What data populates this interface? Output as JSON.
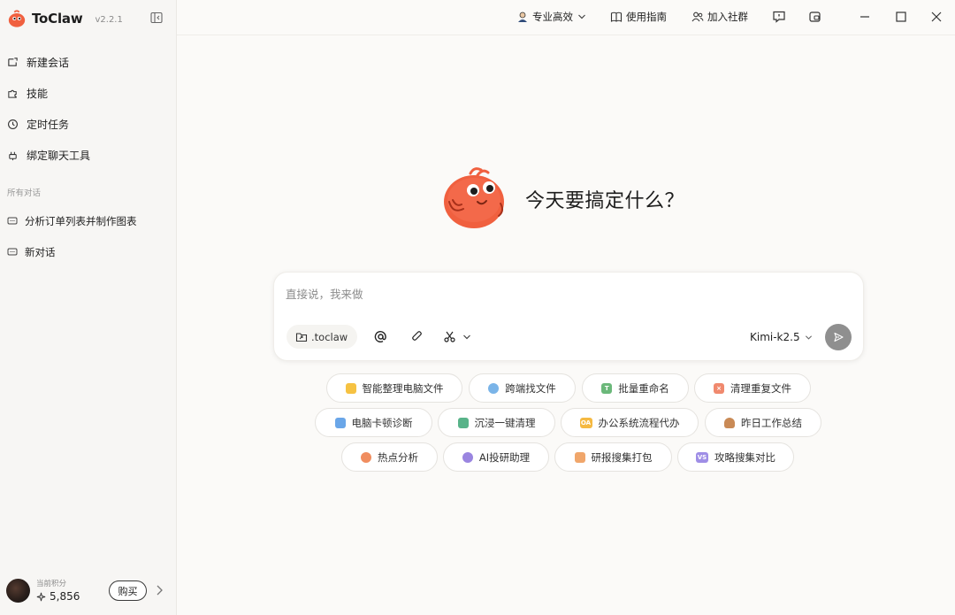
{
  "app": {
    "name": "ToClaw",
    "version": "v2.2.1"
  },
  "sidebar": {
    "nav": [
      {
        "label": "新建会话",
        "icon": "new-chat-icon"
      },
      {
        "label": "技能",
        "icon": "puzzle-icon"
      },
      {
        "label": "定时任务",
        "icon": "clock-icon"
      },
      {
        "label": "绑定聊天工具",
        "icon": "plug-icon"
      }
    ],
    "section_label": "所有对话",
    "chats": [
      {
        "label": "分析订单列表并制作图表",
        "icon": "chat-bubble-icon"
      },
      {
        "label": "新对话",
        "icon": "chat-bubble-icon"
      }
    ],
    "footer": {
      "points_label": "当前积分",
      "points_value": "5,856",
      "buy_label": "购买"
    }
  },
  "topbar": {
    "mode_label": "专业高效",
    "guide_label": "使用指南",
    "community_label": "加入社群"
  },
  "hero": {
    "title": "今天要搞定什么？"
  },
  "composer": {
    "placeholder": "直接说，我来做",
    "folder_label": ".toclaw",
    "model_label": "Kimi-k2.5"
  },
  "suggestions": [
    {
      "label": "智能整理电脑文件",
      "icon": "folder-icon",
      "color": "#f6c242"
    },
    {
      "label": "跨端找文件",
      "icon": "search-icon",
      "color": "#7ab4e8"
    },
    {
      "label": "批量重命名",
      "icon": "rename-icon",
      "color": "#6bb87a",
      "glyph": "T"
    },
    {
      "label": "清理重复文件",
      "icon": "delete-icon",
      "color": "#f0896e"
    },
    {
      "label": "电脑卡顿诊断",
      "icon": "monitor-icon",
      "color": "#6aa6e8"
    },
    {
      "label": "沉浸一键清理",
      "icon": "broom-icon",
      "color": "#58b389"
    },
    {
      "label": "办公系统流程代办",
      "icon": "oa-icon",
      "color": "#f5b942",
      "glyph": "OA"
    },
    {
      "label": "昨日工作总结",
      "icon": "cake-icon",
      "color": "#c98a56"
    },
    {
      "label": "热点分析",
      "icon": "fire-icon",
      "color": "#f08d5f"
    },
    {
      "label": "AI投研助理",
      "icon": "ai-chat-icon",
      "color": "#9a85e0"
    },
    {
      "label": "研报搜集打包",
      "icon": "package-icon",
      "color": "#f0a66b"
    },
    {
      "label": "攻略搜集对比",
      "icon": "vs-icon",
      "color": "#9f8ee6",
      "glyph": "VS"
    }
  ]
}
